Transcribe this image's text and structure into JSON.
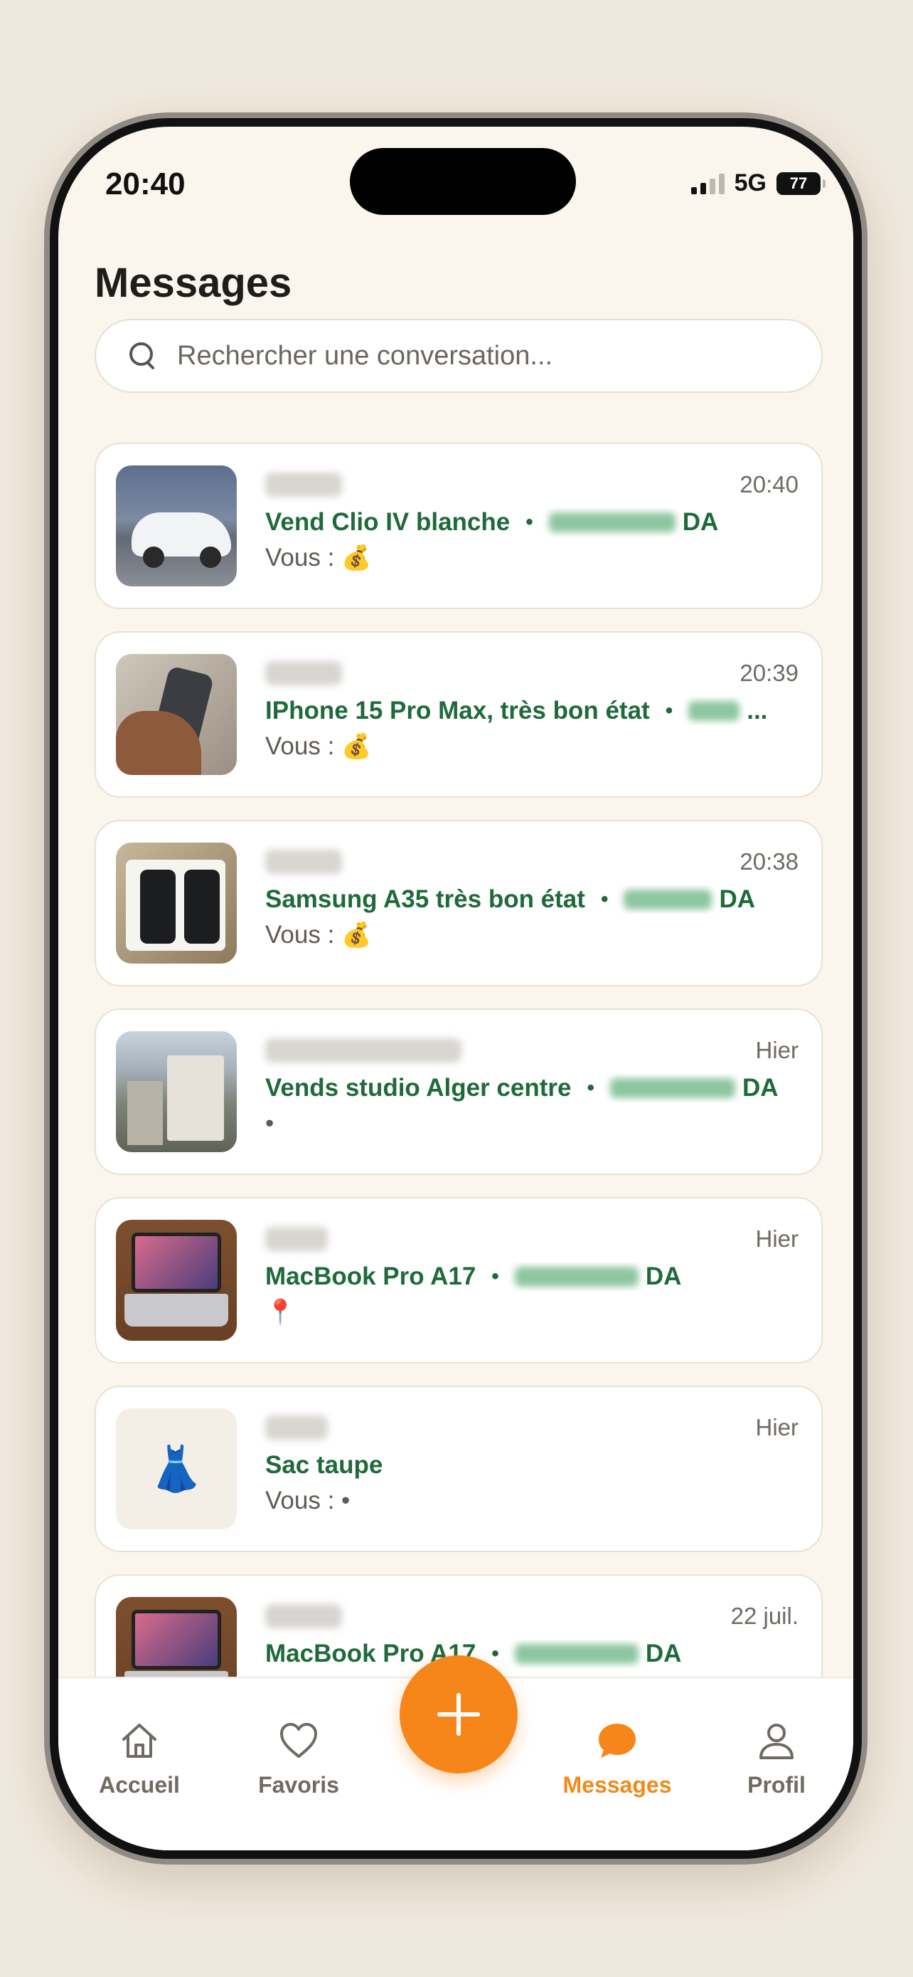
{
  "status_bar": {
    "time": "20:40",
    "network": "5G",
    "battery": "77"
  },
  "header": {
    "title": "Messages"
  },
  "search": {
    "placeholder": "Rechercher une conversation..."
  },
  "conversations": [
    {
      "time": "20:40",
      "title": "Vend Clio IV blanche",
      "separator": "•",
      "currency": "DA",
      "preview": "Vous : ",
      "preview_emoji": "💰",
      "thumbnail": "car"
    },
    {
      "time": "20:39",
      "title": "IPhone 15 Pro Max, très bon état",
      "separator": "•",
      "currency": "...",
      "preview": "Vous : ",
      "preview_emoji": "💰",
      "thumbnail": "phone"
    },
    {
      "time": "20:38",
      "title": "Samsung A35 très bon état",
      "separator": "•",
      "currency": "DA",
      "preview": "Vous : ",
      "preview_emoji": "💰",
      "thumbnail": "boxed-phone"
    },
    {
      "time": "Hier",
      "title": "Vends studio Alger centre",
      "separator": "•",
      "currency": "DA",
      "preview": "•",
      "preview_emoji": "",
      "thumbnail": "city"
    },
    {
      "time": "Hier",
      "title": "MacBook Pro A17",
      "separator": "•",
      "currency": "DA",
      "preview": "",
      "preview_emoji": "📍",
      "thumbnail": "laptop"
    },
    {
      "time": "Hier",
      "title": "Sac taupe",
      "separator": "",
      "currency": "",
      "preview": "Vous : •",
      "preview_emoji": "",
      "thumbnail": "dress-emoji",
      "thumbnail_emoji": "👗"
    },
    {
      "time": "22 juil.",
      "title": "MacBook Pro A17",
      "separator": "•",
      "currency": "DA",
      "preview": "",
      "preview_emoji": "",
      "thumbnail": "laptop"
    }
  ],
  "bottom_nav": {
    "items": [
      {
        "label": "Accueil",
        "icon": "home-icon"
      },
      {
        "label": "Favoris",
        "icon": "heart-icon"
      },
      {
        "label": "Messages",
        "icon": "chat-bubble-icon",
        "active": true
      },
      {
        "label": "Profil",
        "icon": "user-icon"
      }
    ],
    "fab_icon": "plus-icon"
  },
  "colors": {
    "accent": "#f7861a",
    "title_green": "#1f6a3a",
    "background": "#faf6ee"
  }
}
